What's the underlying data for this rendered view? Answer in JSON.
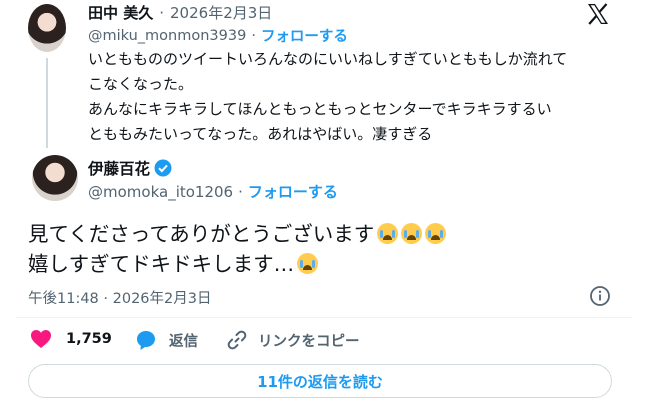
{
  "quoted": {
    "name": "田中 美久",
    "separator": "·",
    "date": "2026年2月3日",
    "handle": "@miku_monmon3939",
    "follow_label": "フォローする",
    "lines": [
      "いとももののツイートいろんなのにいいねしすぎていとももしか流れて",
      "こなくなった。",
      "あんなにキラキラしてほんともっともっとセンターでキラキラするい",
      "とももみたいってなった。あれはやばい。凄すぎる"
    ]
  },
  "post": {
    "name": "伊藤百花",
    "handle": "@momoka_ito1206",
    "separator": "·",
    "follow_label": "フォローする",
    "line1": "見てくださってありがとうございます",
    "line2": "嬉しすぎてドキドキします…",
    "timestamp": "午後11:48 · 2026年2月3日"
  },
  "actions": {
    "likes": "1,759",
    "reply_label": "返信",
    "copy_link_label": "リンクをコピー"
  },
  "read_replies_label": "11件の返信を読む",
  "icons": {
    "close": "x-logo-icon",
    "verified": "verified-badge-icon",
    "info": "info-icon",
    "like": "heart-icon",
    "reply": "reply-bubble-icon",
    "link": "link-icon",
    "emoji": "loudly-crying-face-emoji"
  },
  "colors": {
    "accent": "#1d9bf0",
    "like": "#f91880",
    "text": "#0f1419",
    "secondary": "#536471"
  }
}
